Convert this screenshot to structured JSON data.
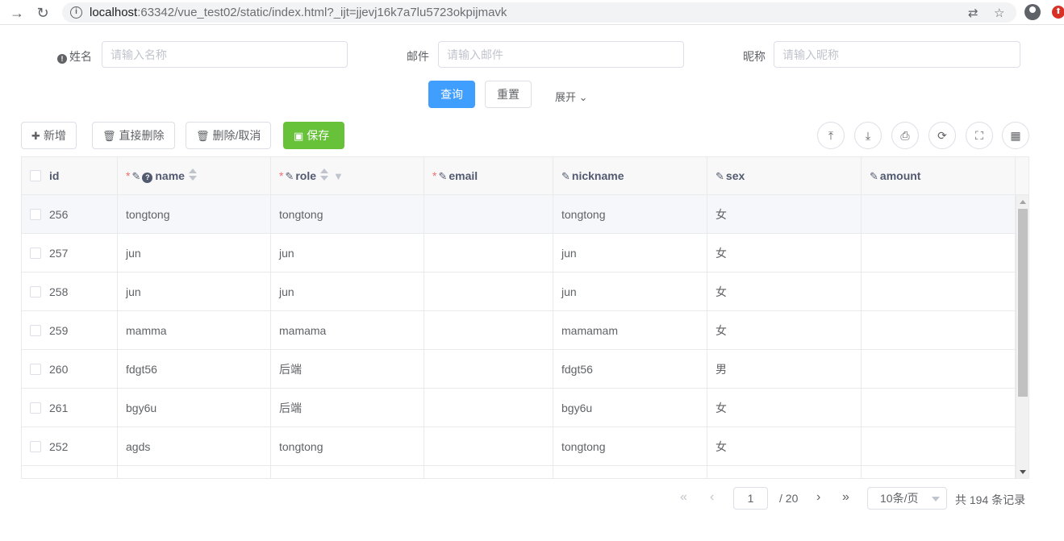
{
  "browser": {
    "back_icon": "arrow-right-icon",
    "url_host": "localhost",
    "url_path": ":63342/vue_test02/static/index.html?_ijt=jjevj16k7a7lu5723okpijmavk"
  },
  "form": {
    "name_label": "姓名",
    "name_placeholder": "请输入名称",
    "email_label": "邮件",
    "email_placeholder": "请输入邮件",
    "nickname_label": "昵称",
    "nickname_placeholder": "请输入昵称",
    "query_label": "查询",
    "reset_label": "重置",
    "expand_label": "展开"
  },
  "toolbar": {
    "add_label": "新增",
    "delete_label": "直接删除",
    "delete_cancel_label": "删除/取消",
    "save_label": "保存"
  },
  "table": {
    "columns": [
      "id",
      "name",
      "role",
      "email",
      "nickname",
      "sex",
      "amount"
    ],
    "rows": [
      {
        "id": "256",
        "name": "tongtong",
        "role": "tongtong",
        "email": "",
        "nickname": "tongtong",
        "sex": "女",
        "amount": ""
      },
      {
        "id": "257",
        "name": "jun",
        "role": "jun",
        "email": "",
        "nickname": "jun",
        "sex": "女",
        "amount": ""
      },
      {
        "id": "258",
        "name": "jun",
        "role": "jun",
        "email": "",
        "nickname": "jun",
        "sex": "女",
        "amount": ""
      },
      {
        "id": "259",
        "name": "mamma",
        "role": "mamama",
        "email": "",
        "nickname": "mamamam",
        "sex": "女",
        "amount": ""
      },
      {
        "id": "260",
        "name": "fdgt56",
        "role": "后端",
        "email": "",
        "nickname": "fdgt56",
        "sex": "男",
        "amount": ""
      },
      {
        "id": "261",
        "name": "bgy6u",
        "role": "后端",
        "email": "",
        "nickname": "bgy6u",
        "sex": "女",
        "amount": ""
      },
      {
        "id": "252",
        "name": "agds",
        "role": "tongtong",
        "email": "",
        "nickname": "tongtong",
        "sex": "女",
        "amount": ""
      }
    ]
  },
  "pager": {
    "current_page": "1",
    "total_pages": "/ 20",
    "page_size": "10条/页",
    "total_records": "共 194 条记录"
  }
}
